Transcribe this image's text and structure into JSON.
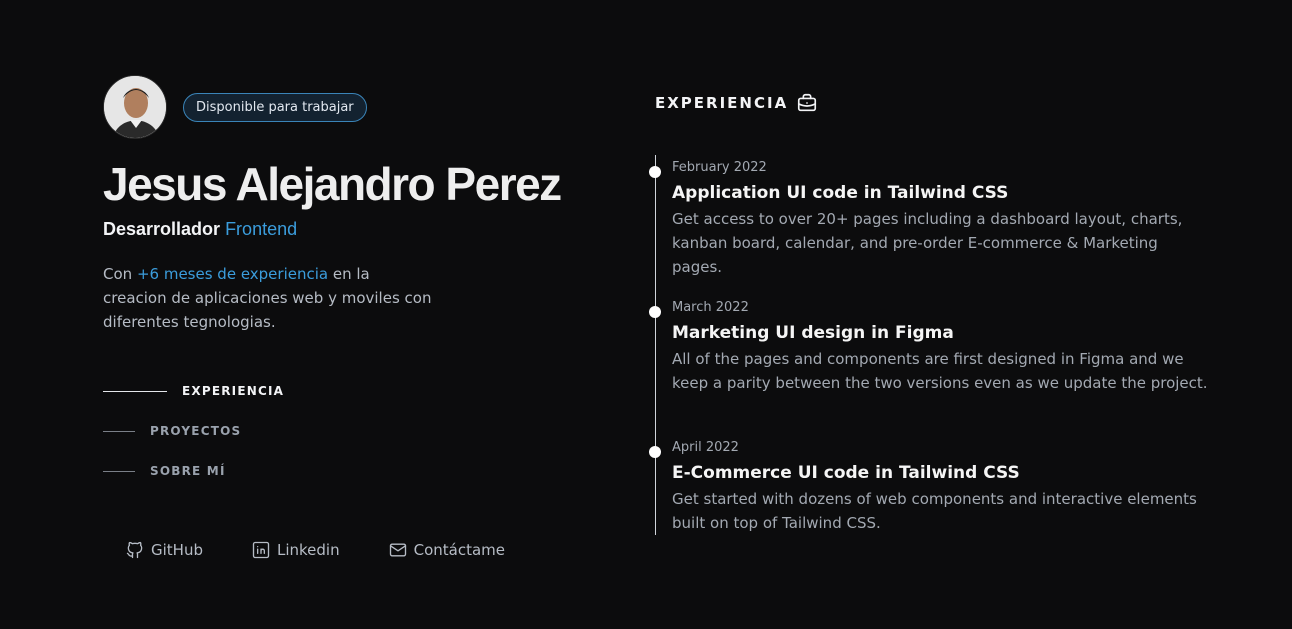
{
  "profile": {
    "badge": "Disponible para trabajar",
    "name": "Jesus Alejandro Perez",
    "role_prefix": "Desarrollador",
    "role_accent": "Frontend",
    "bio_prefix": "Con",
    "bio_accent": "+6 meses de experiencia",
    "bio_suffix": "en la creacion de aplicaciones web y moviles con diferentes tegnologias."
  },
  "nav": [
    {
      "label": "EXPERIENCIA",
      "active": true
    },
    {
      "label": "PROYECTOS",
      "active": false
    },
    {
      "label": "SOBRE MÍ",
      "active": false
    }
  ],
  "socials": [
    {
      "label": "GitHub",
      "icon": "github-icon"
    },
    {
      "label": "Linkedin",
      "icon": "linkedin-icon"
    },
    {
      "label": "Contáctame",
      "icon": "mail-icon"
    }
  ],
  "experience": {
    "title": "EXPERIENCIA",
    "icon": "briefcase-icon",
    "items": [
      {
        "date": "February 2022",
        "title": "Application UI code in Tailwind CSS",
        "text": "Get access to over 20+ pages including a dashboard layout, charts, kanban board, calendar, and pre-order E-commerce & Marketing pages."
      },
      {
        "date": "March 2022",
        "title": "Marketing UI design in Figma",
        "text": "All of the pages and components are first designed in Figma and we keep a parity between the two versions even as we update the project."
      },
      {
        "date": "April 2022",
        "title": "E-Commerce UI code in Tailwind CSS",
        "text": "Get started with dozens of web components and interactive elements built on top of Tailwind CSS."
      }
    ]
  },
  "colors": {
    "background": "#0c0c0d",
    "accent": "#3b9ddc",
    "badge_border": "#3a84b8"
  }
}
